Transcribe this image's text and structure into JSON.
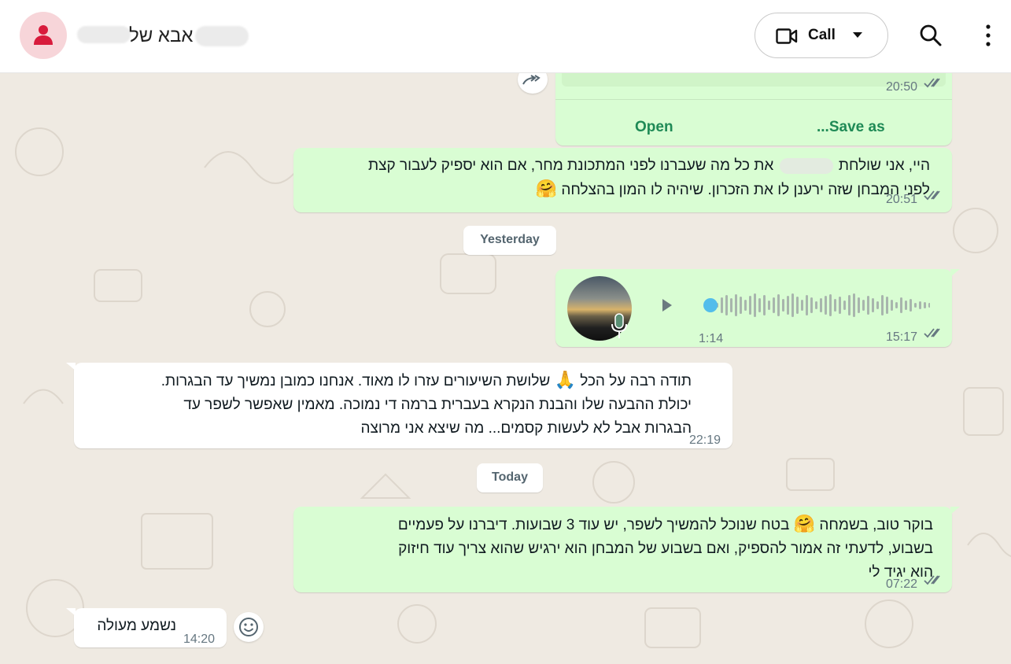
{
  "header": {
    "contact_name": "אבא של",
    "call_label": "Call"
  },
  "file_message": {
    "time": "20:50",
    "open_label": "Open",
    "save_label": "Save as..."
  },
  "msg1": {
    "line1_part1": "היי, אני שולחת",
    "line1_part2": "את כל מה שעברנו לפני המתכונת מחר, אם הוא יספיק לעבור קצת",
    "line2": "לפני המבחן שזה ירענן לו את הזכרון. שיהיה לו המון בהצלחה",
    "emoji": "🤗",
    "time": "20:51"
  },
  "day_yesterday": "Yesterday",
  "voice": {
    "duration": "1:14",
    "time": "15:17",
    "progress": 0
  },
  "msg2": {
    "line1_part1": "תודה רבה על הכל",
    "emoji": "🙏",
    "line1_part2": "שלושת השיעורים עזרו לו מאוד. אנחנו כמובן נמשיך עד הבגרות.",
    "line2": "יכולת ההבעה שלו והבנת הנקרא בעברית ברמה די נמוכה. מאמין שאפשר לשפר עד",
    "line3": "הבגרות אבל לא לעשות קסמים... מה שיצא אני מרוצה",
    "time": "22:19"
  },
  "day_today": "Today",
  "msg3": {
    "line1_part1": "בוקר טוב, בשמחה",
    "emoji": "🤗",
    "line1_part2": "בטח שנוכל להמשיך לשפר, יש עוד 3 שבועות. דיברנו על פעמיים",
    "line2": "בשבוע, לדעתי זה אמור להספיק, ואם בשבוע של המבחן הוא ירגיש שהוא צריך עוד חיזוק",
    "line3": "הוא יגיד לי",
    "time": "07:22"
  },
  "msg4": {
    "text": "נשמע מעולה",
    "time": "14:20"
  },
  "colors": {
    "outgoing_bubble": "#d9fdd3",
    "incoming_bubble": "#ffffff",
    "accent_green": "#1f8a56",
    "read_ticks": "#667781",
    "voice_progress_dot": "#53bdeb"
  }
}
